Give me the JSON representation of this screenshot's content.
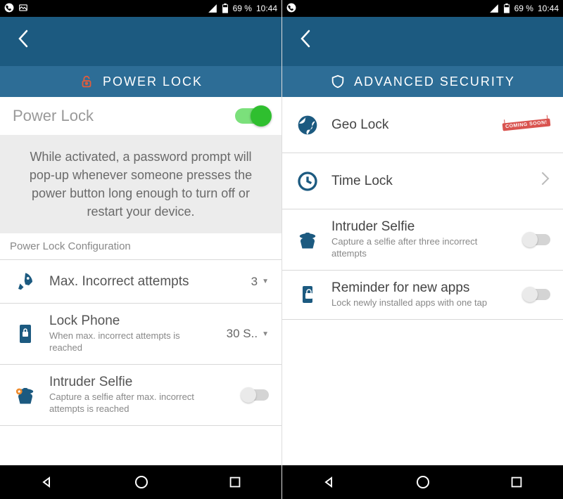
{
  "status": {
    "battery_pct": "69 %",
    "time": "10:44"
  },
  "left": {
    "titlebar": "POWER LOCK",
    "main_title": "Power Lock",
    "main_toggle_on": true,
    "description": "While activated, a password prompt will pop-up whenever someone presses the power button long enough to turn off or restart your device.",
    "config_label": "Power Lock Configuration",
    "rows": {
      "max_attempts": {
        "title": "Max. Incorrect attempts",
        "value": "3"
      },
      "lock_phone": {
        "title": "Lock Phone",
        "subtitle": "When max. incorrect attempts is reached",
        "value": "30 S.."
      },
      "intruder": {
        "title": "Intruder Selfie",
        "subtitle": "Capture a selfie after max. incorrect attempts is reached"
      }
    }
  },
  "right": {
    "titlebar": "ADVANCED SECURITY",
    "rows": {
      "geo": {
        "title": "Geo Lock",
        "badge": "COMING SOON!"
      },
      "time": {
        "title": "Time Lock"
      },
      "intruder": {
        "title": "Intruder Selfie",
        "subtitle": "Capture a selfie after three incorrect attempts"
      },
      "reminder": {
        "title": "Reminder for new apps",
        "subtitle": "Lock newly installed apps with one tap"
      }
    }
  }
}
